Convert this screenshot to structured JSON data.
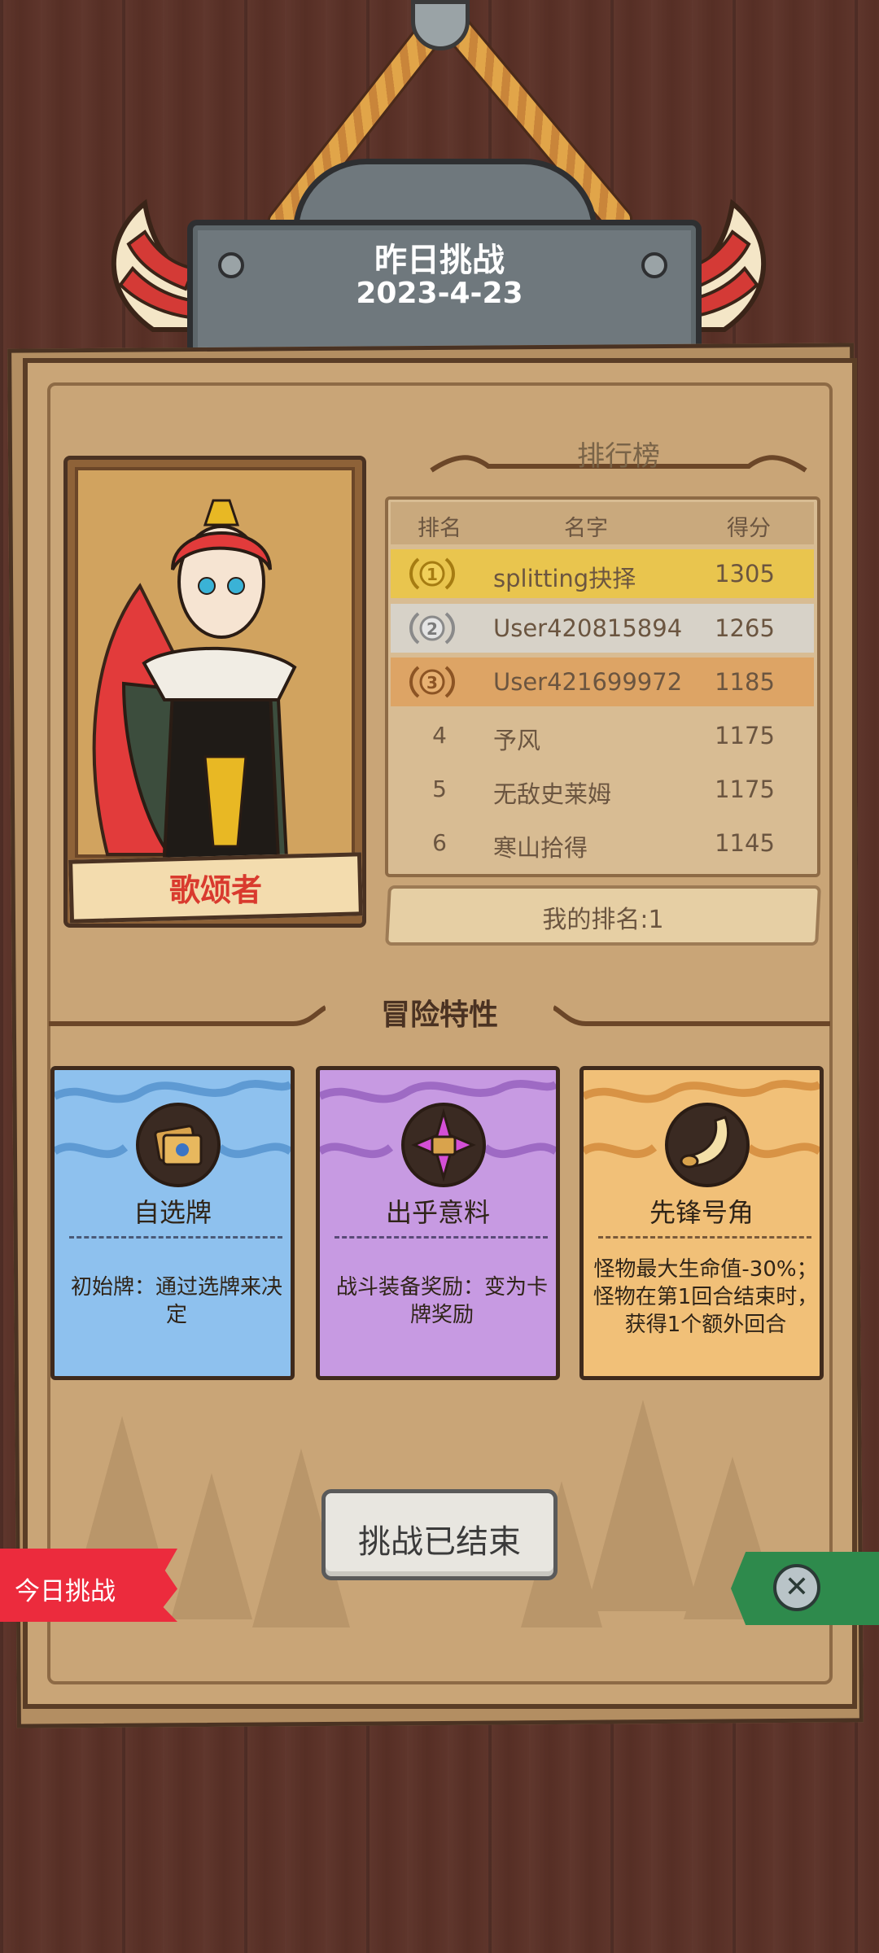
{
  "sign": {
    "title": "昨日挑战",
    "date": "2023-4-23"
  },
  "hero": {
    "name": "歌颂者"
  },
  "leaderboard": {
    "title": "排行榜",
    "headers": {
      "rank": "排名",
      "name": "名字",
      "score": "得分"
    },
    "rows": [
      {
        "rank": "1",
        "name": "splitting抉择",
        "score": "1305",
        "highlight": "#e9c54e",
        "medal": "gold"
      },
      {
        "rank": "2",
        "name": "User420815894",
        "score": "1265",
        "highlight": "#d7d2c8",
        "medal": "silver"
      },
      {
        "rank": "3",
        "name": "User421699972",
        "score": "1185",
        "highlight": "#dda465",
        "medal": "bronze"
      },
      {
        "rank": "4",
        "name": "予风",
        "score": "1175"
      },
      {
        "rank": "5",
        "name": "无敌史莱姆",
        "score": "1175"
      },
      {
        "rank": "6",
        "name": "寒山拾得",
        "score": "1145"
      }
    ],
    "my_rank": "我的排名:1"
  },
  "traits": {
    "title": "冒险特性",
    "cards": [
      {
        "name": "自选牌",
        "desc": "初始牌：通过选牌来决定",
        "icon": "cards-icon",
        "color": "#8ec1ee"
      },
      {
        "name": "出乎意料",
        "desc": "战斗装备奖励：变为卡牌奖励",
        "icon": "chest-icon",
        "color": "#c79ae2"
      },
      {
        "name": "先锋号角",
        "desc": "怪物最大生命值-30%；怪物在第1回合结束时，获得1个额外回合",
        "icon": "horn-icon",
        "color": "#f1c078"
      }
    ]
  },
  "buttons": {
    "ended": "挑战已结束",
    "today": "今日挑战"
  },
  "colors": {
    "board": "#c9a577",
    "tab_red": "#ec2b3d",
    "tab_green": "#2e8a4c"
  }
}
